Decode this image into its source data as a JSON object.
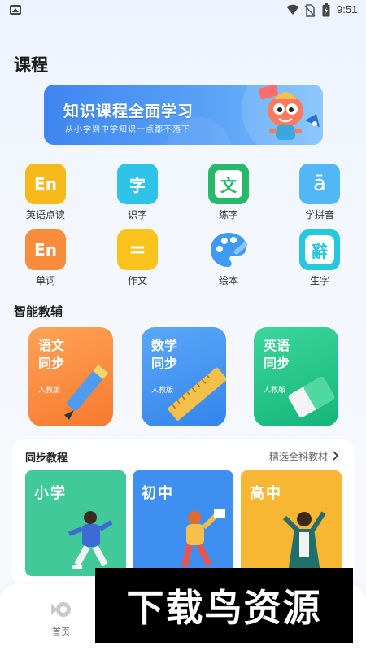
{
  "status_bar": {
    "time": "9:51"
  },
  "page": {
    "title": "课程"
  },
  "banner": {
    "title": "知识课程全面学习",
    "subtitle": "从小学到中学知识一点都不落下"
  },
  "features": [
    {
      "label": "英语点读",
      "icon_text": "En",
      "icon": "en-icon",
      "color": "#f7b81c"
    },
    {
      "label": "识字",
      "icon_text": "字",
      "icon": "zi-icon",
      "color": "#2fc3ea"
    },
    {
      "label": "练字",
      "icon_text": "文",
      "icon": "wen-icon",
      "color": "#26b96a"
    },
    {
      "label": "学拼音",
      "icon_text": "ā",
      "icon": "pinyin-icon",
      "color": "#52b7f5"
    },
    {
      "label": "单词",
      "icon_text": "En",
      "icon": "en-icon",
      "color": "#f98c3a"
    },
    {
      "label": "作文",
      "icon_text": "=",
      "icon": "composition-icon",
      "color": "#f9c21c"
    },
    {
      "label": "绘本",
      "icon_text": "",
      "icon": "palette-icon",
      "color": "#3e9af2"
    },
    {
      "label": "生字",
      "icon_text": "辭",
      "icon": "shengzi-icon",
      "color": "#26c7df"
    }
  ],
  "smart": {
    "title": "智能教辅",
    "cards": [
      {
        "title": "语文同步",
        "badge": "人教版",
        "color": "#fb8e3f"
      },
      {
        "title": "数学同步",
        "badge": "人教版",
        "color": "#3f95f3"
      },
      {
        "title": "英语同步",
        "badge": "人教版",
        "color": "#20c584"
      }
    ]
  },
  "sync": {
    "title": "同步教程",
    "link": "精选全科教材",
    "levels": [
      {
        "label": "小学",
        "color": "#41c99a"
      },
      {
        "label": "初中",
        "color": "#3e8ff0"
      },
      {
        "label": "高中",
        "color": "#f7b733"
      }
    ]
  },
  "tabbar": {
    "home_label": "首页"
  },
  "watermark": {
    "text": "下载鸟资源"
  }
}
